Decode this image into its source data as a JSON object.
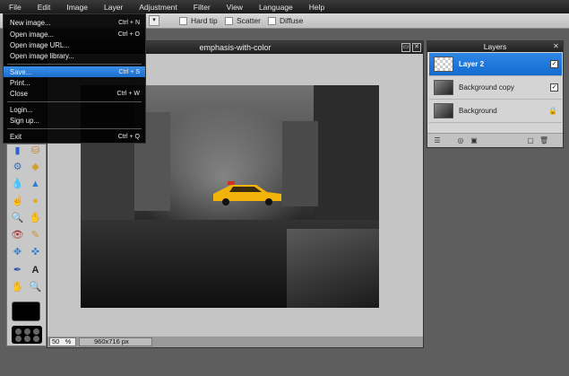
{
  "menubar": {
    "items": [
      "File",
      "Edit",
      "Image",
      "Layer",
      "Adjustment",
      "Filter",
      "View",
      "Language",
      "Help"
    ]
  },
  "options": {
    "hard_tip": "Hard tip",
    "scatter": "Scatter",
    "diffuse": "Diffuse"
  },
  "file_menu": {
    "items": [
      {
        "label": "New image...",
        "shortcut": "Ctrl + N"
      },
      {
        "label": "Open image...",
        "shortcut": "Ctrl + O"
      },
      {
        "label": "Open image URL...",
        "shortcut": ""
      },
      {
        "label": "Open image library...",
        "shortcut": ""
      },
      {
        "label": "Save...",
        "shortcut": "Ctrl + S"
      },
      {
        "label": "Print...",
        "shortcut": ""
      },
      {
        "label": "Close",
        "shortcut": "Ctrl + W"
      },
      {
        "label": "Login...",
        "shortcut": ""
      },
      {
        "label": "Sign up...",
        "shortcut": ""
      },
      {
        "label": "Exit",
        "shortcut": "Ctrl + Q"
      }
    ]
  },
  "image_window": {
    "title": "emphasis-with-color",
    "zoom_value": "50",
    "zoom_unit": "%",
    "dimensions": "960x716 px"
  },
  "layers_panel": {
    "title": "Layers",
    "layers": [
      {
        "name": "Layer 2"
      },
      {
        "name": "Background copy"
      },
      {
        "name": "Background"
      }
    ]
  },
  "colors": {
    "highlight": "#2e86e6",
    "menubar": "#1c1c1c",
    "taxi": "#f2b40a"
  }
}
